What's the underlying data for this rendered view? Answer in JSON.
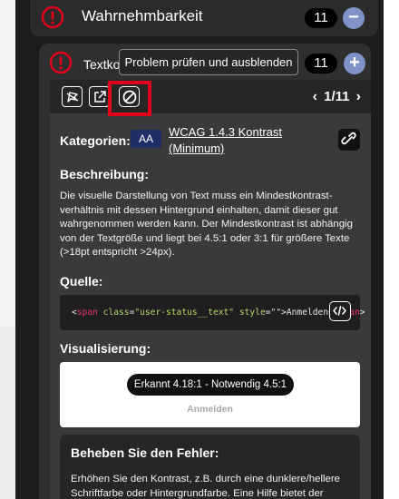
{
  "category": {
    "title": "Wahrnehmbarkeit",
    "count": "11",
    "toggle": "−"
  },
  "issue": {
    "title": "Textko",
    "count": "11",
    "toggle": "+"
  },
  "tooltip": "Problem prüfen und ausblenden",
  "toolbar": {
    "pager": "1/11",
    "prev": "‹",
    "next": "›"
  },
  "details": {
    "categories_label": "Kategorien:",
    "level_badge": "AA",
    "wcag_link": "WCAG 1.4.3 Kontrast (Minimum)",
    "description_label": "Beschreibung:",
    "description": "Die visuelle Darstellung von Text muss ein Mindestkontrast-verhältnis mit dessen Hintergrund einhalten, damit dieser gut wahrgenommen werden kann. Der Mindestkontrast ist abhängig von der Textgröße und liegt bei 4.5:1 oder 3:1 für größere Texte (>18pt entspricht >24px).",
    "source_label": "Quelle:",
    "source_code": {
      "open_bracket": "<",
      "tag": "span",
      "attr1": "class",
      "val1": "\"user-status__text\"",
      "attr2": "style",
      "val2": "\"\"",
      "content": ">Anmelden</",
      "close_tag": "span",
      "close_bracket": ">"
    },
    "visualization_label": "Visualisierung:",
    "contrast": "Erkannt 4.18:1 - Notwendig 4.5:1",
    "sample_text": "Anmelden",
    "fix_title": "Beheben Sie den Fehler:",
    "fix_text": "Erhöhen Sie den Kontrast, z.B. durch eine dunklere/hellere Schriftfarbe oder Hintergrundfarbe. Eine Hilfe bietet der"
  },
  "colors": {
    "alert_red": "#e3001b",
    "accent_blue": "#7f93c9",
    "badge_navy": "#1f2e66",
    "code_tag": "#e8336b",
    "code_attr": "#b4d86a"
  },
  "icons": {
    "alert": "exclamation-circle-icon",
    "ignore": "flag-ignore-icon",
    "open": "external-link-icon",
    "hide": "block-icon",
    "link": "chain-link-icon",
    "code": "code-brackets-icon"
  }
}
